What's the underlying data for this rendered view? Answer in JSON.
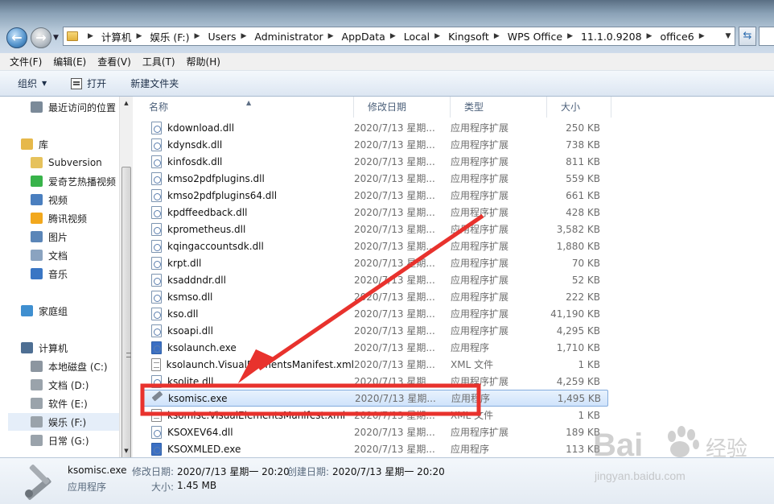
{
  "address": {
    "crumbs": [
      "计算机",
      "娱乐 (F:)",
      "Users",
      "Administrator",
      "AppData",
      "Local",
      "Kingsoft",
      "WPS Office",
      "11.1.0.9208",
      "office6"
    ]
  },
  "menu": [
    "文件(F)",
    "编辑(E)",
    "查看(V)",
    "工具(T)",
    "帮助(H)"
  ],
  "commands": {
    "organize": "组织",
    "open": "打开",
    "new_folder": "新建文件夹"
  },
  "sidebar": {
    "items": [
      {
        "label": "最近访问的位置",
        "icon": "recent-places-icon",
        "color": "#7b8a99"
      },
      {
        "label": "库",
        "icon": "library-icon",
        "color": "#e6b84a"
      },
      {
        "label": "Subversion",
        "icon": "folder-icon",
        "color": "#e6c25c"
      },
      {
        "label": "爱奇艺热播视频",
        "icon": "iqiyi-icon",
        "color": "#38b34a"
      },
      {
        "label": "视频",
        "icon": "video-library-icon",
        "color": "#4a7fbf"
      },
      {
        "label": "腾讯视频",
        "icon": "tencent-video-icon",
        "color": "#f2a81d"
      },
      {
        "label": "图片",
        "icon": "pictures-library-icon",
        "color": "#5b86b8"
      },
      {
        "label": "文档",
        "icon": "documents-library-icon",
        "color": "#8aa3c0"
      },
      {
        "label": "音乐",
        "icon": "music-library-icon",
        "color": "#3a76c4"
      },
      {
        "label": "家庭组",
        "icon": "homegroup-icon",
        "color": "#3f8fd0"
      },
      {
        "label": "计算机",
        "icon": "computer-icon",
        "color": "#4e6f93"
      },
      {
        "label": "本地磁盘 (C:)",
        "icon": "system-drive-icon",
        "color": "#8c96a0"
      },
      {
        "label": "文档 (D:)",
        "icon": "drive-icon",
        "color": "#9aa3ab"
      },
      {
        "label": "软件 (E:)",
        "icon": "drive-icon",
        "color": "#9aa3ab"
      },
      {
        "label": "娱乐 (F:)",
        "icon": "drive-icon",
        "color": "#9aa3ab"
      },
      {
        "label": "日常 (G:)",
        "icon": "drive-icon",
        "color": "#9aa3ab"
      }
    ],
    "selected": "娱乐 (F:)"
  },
  "columns": [
    "名称",
    "修改日期",
    "类型",
    "大小"
  ],
  "files": [
    {
      "name": "kdownload.dll",
      "date": "2020/7/13 星期...",
      "type": "应用程序扩展",
      "size": "250 KB",
      "icon": "dll"
    },
    {
      "name": "kdynsdk.dll",
      "date": "2020/7/13 星期...",
      "type": "应用程序扩展",
      "size": "738 KB",
      "icon": "dll"
    },
    {
      "name": "kinfosdk.dll",
      "date": "2020/7/13 星期...",
      "type": "应用程序扩展",
      "size": "811 KB",
      "icon": "dll"
    },
    {
      "name": "kmso2pdfplugins.dll",
      "date": "2020/7/13 星期...",
      "type": "应用程序扩展",
      "size": "559 KB",
      "icon": "dll"
    },
    {
      "name": "kmso2pdfplugins64.dll",
      "date": "2020/7/13 星期...",
      "type": "应用程序扩展",
      "size": "661 KB",
      "icon": "dll"
    },
    {
      "name": "kpdffeedback.dll",
      "date": "2020/7/13 星期...",
      "type": "应用程序扩展",
      "size": "428 KB",
      "icon": "dll"
    },
    {
      "name": "kprometheus.dll",
      "date": "2020/7/13 星期...",
      "type": "应用程序扩展",
      "size": "3,582 KB",
      "icon": "dll"
    },
    {
      "name": "kqingaccountsdk.dll",
      "date": "2020/7/13 星期...",
      "type": "应用程序扩展",
      "size": "1,880 KB",
      "icon": "dll"
    },
    {
      "name": "krpt.dll",
      "date": "2020/7/13 星期...",
      "type": "应用程序扩展",
      "size": "70 KB",
      "icon": "dll"
    },
    {
      "name": "ksaddndr.dll",
      "date": "2020/7/13 星期...",
      "type": "应用程序扩展",
      "size": "52 KB",
      "icon": "dll"
    },
    {
      "name": "ksmso.dll",
      "date": "2020/7/13 星期...",
      "type": "应用程序扩展",
      "size": "222 KB",
      "icon": "dll"
    },
    {
      "name": "kso.dll",
      "date": "2020/7/13 星期...",
      "type": "应用程序扩展",
      "size": "41,190 KB",
      "icon": "dll"
    },
    {
      "name": "ksoapi.dll",
      "date": "2020/7/13 星期...",
      "type": "应用程序扩展",
      "size": "4,295 KB",
      "icon": "dll"
    },
    {
      "name": "ksolaunch.exe",
      "date": "2020/7/13 星期...",
      "type": "应用程序",
      "size": "1,710 KB",
      "icon": "exe"
    },
    {
      "name": "ksolaunch.VisualElementsManifest.xml",
      "date": "2020/7/13 星期...",
      "type": "XML 文件",
      "size": "1 KB",
      "icon": "xml"
    },
    {
      "name": "ksolite.dll",
      "date": "2020/7/13 星期...",
      "type": "应用程序扩展",
      "size": "4,259 KB",
      "icon": "dll"
    },
    {
      "name": "ksomisc.exe",
      "date": "2020/7/13 星期...",
      "type": "应用程序",
      "size": "1,495 KB",
      "icon": "tool"
    },
    {
      "name": "ksomisc.VisualElementsManifest.xml",
      "date": "2020/7/13 星期...",
      "type": "XML 文件",
      "size": "1 KB",
      "icon": "xml"
    },
    {
      "name": "KSOXEV64.dll",
      "date": "2020/7/13 星期...",
      "type": "应用程序扩展",
      "size": "189 KB",
      "icon": "dll"
    },
    {
      "name": "KSOXMLED.exe",
      "date": "2020/7/13 星期...",
      "type": "应用程序",
      "size": "113 KB",
      "icon": "exe"
    }
  ],
  "selected_file": "ksomisc.exe",
  "details": {
    "name": "ksomisc.exe",
    "modified_label": "修改日期:",
    "modified": "2020/7/13 星期一 20:20",
    "created_label": "创建日期:",
    "created": "2020/7/13 星期一 20:20",
    "type": "应用程序",
    "size_label": "大小:",
    "size": "1.45 MB"
  },
  "annotation_color": "#e8322d",
  "watermark": {
    "brand": "Bai",
    "brand2": "经验",
    "url": "jingyan.baidu.com"
  }
}
